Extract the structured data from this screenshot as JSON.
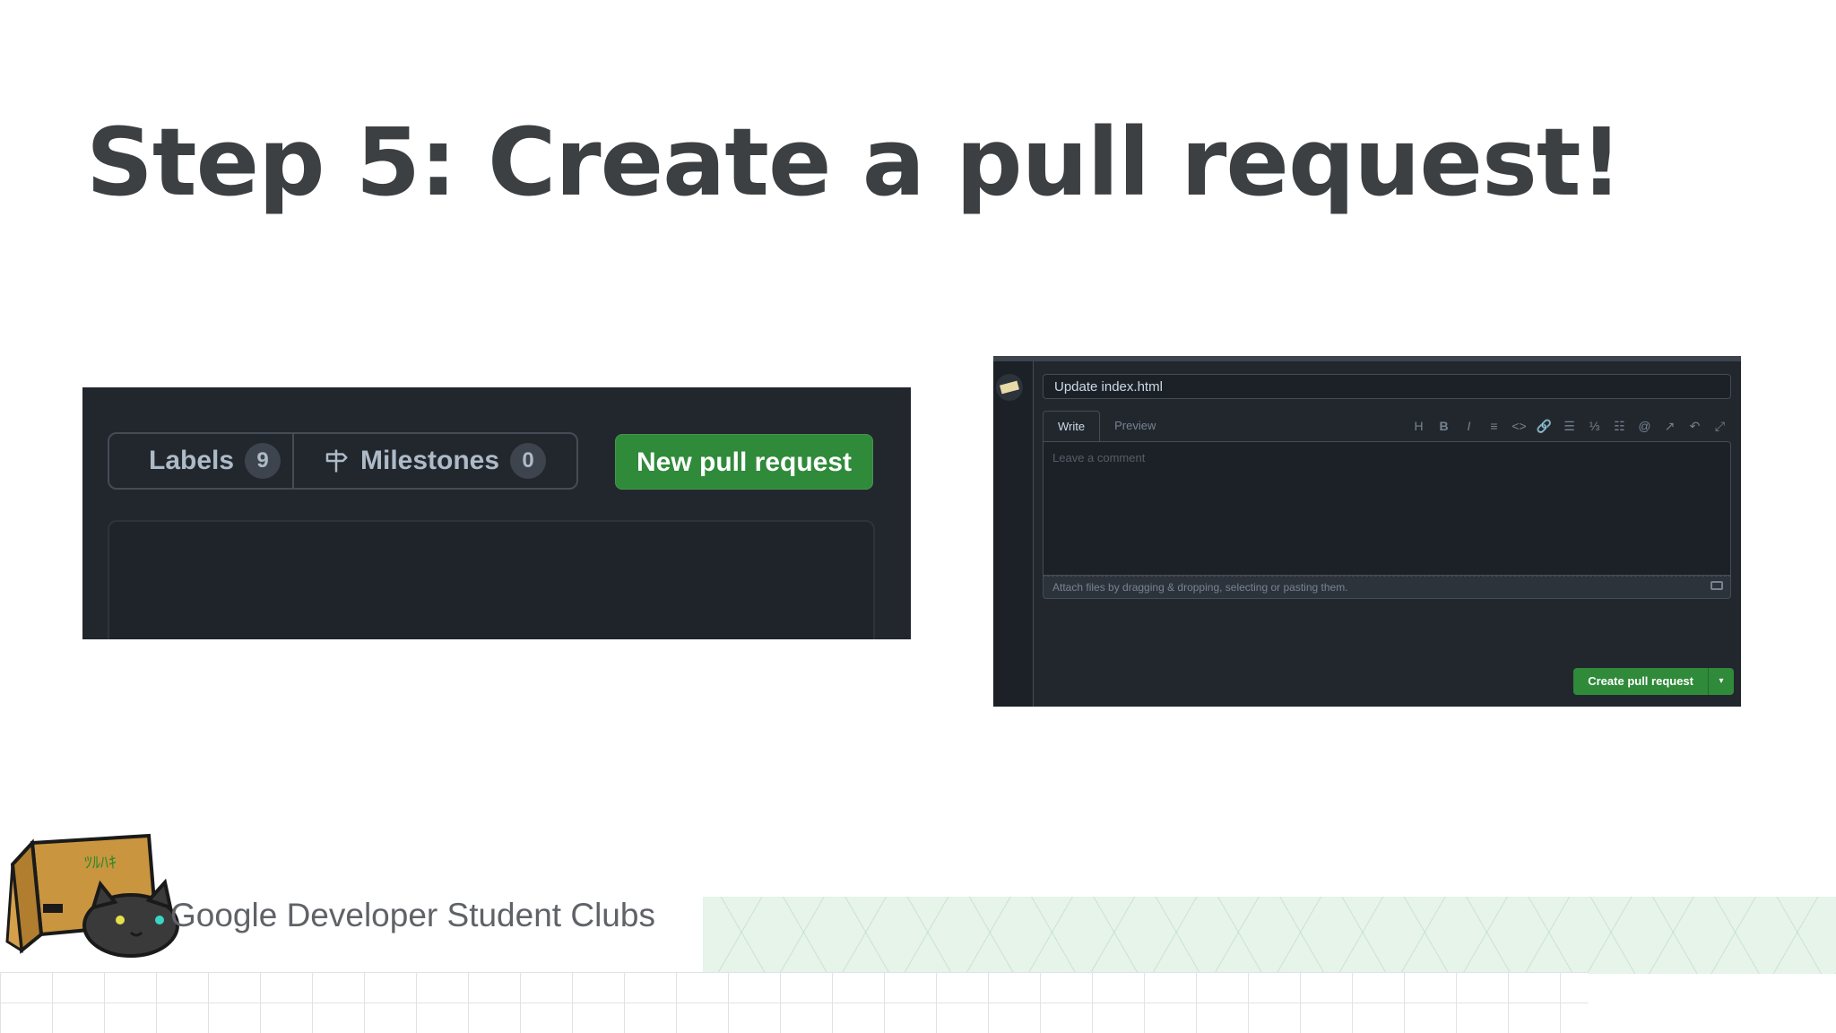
{
  "slide": {
    "title": "Step 5: Create a pull request!",
    "footer_brand": "Google Developer Student Clubs"
  },
  "left_screenshot": {
    "labels_button": {
      "label": "Labels",
      "count": "9",
      "icon": "tag-icon"
    },
    "milestones_button": {
      "label": "Milestones",
      "count": "0",
      "icon": "milestone-icon"
    },
    "new_pr_button": {
      "label": "New pull request"
    }
  },
  "right_screenshot": {
    "title_input_value": "Update index.html",
    "tabs": [
      {
        "label": "Write",
        "active": true
      },
      {
        "label": "Preview",
        "active": false
      }
    ],
    "toolbar_icons": [
      "heading-icon",
      "bold-icon",
      "italic-icon",
      "quote-icon",
      "code-icon",
      "link-icon",
      "unordered-list-icon",
      "ordered-list-icon",
      "task-list-icon",
      "mention-icon",
      "reference-icon",
      "undo-icon",
      "fullscreen-icon"
    ],
    "toolbar_glyphs": [
      "H",
      "B",
      "I",
      "≡",
      "<>",
      "🔗",
      "☰",
      "⅓",
      "☷",
      "@",
      "↗",
      "↶",
      "⤢"
    ],
    "comment_placeholder": "Leave a comment",
    "attach_hint": "Attach files by dragging & dropping, selecting or pasting them.",
    "create_button": {
      "label": "Create pull request",
      "caret": "▾"
    }
  },
  "colors": {
    "dark_bg": "#22272e",
    "green_button": "#2f8a3a",
    "title_text": "#3c4043"
  }
}
